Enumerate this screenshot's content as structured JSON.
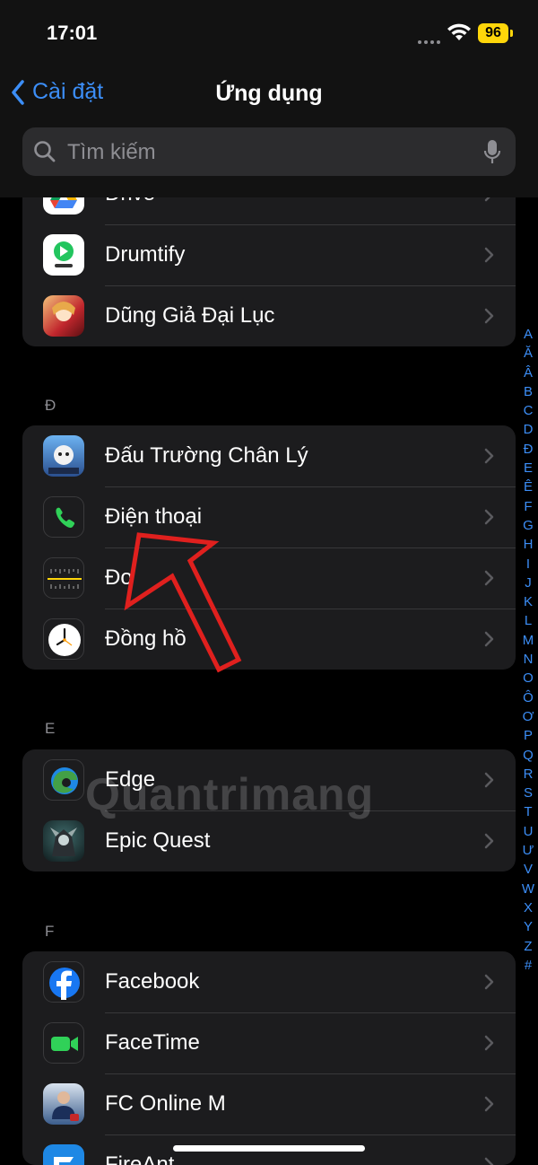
{
  "status": {
    "time": "17:01",
    "battery": "96"
  },
  "nav": {
    "back_label": "Cài đặt",
    "title": "Ứng dụng"
  },
  "search": {
    "placeholder": "Tìm kiếm"
  },
  "sections": {
    "d_top": {
      "items": [
        {
          "label": "Drive",
          "icon": "google-drive-icon"
        },
        {
          "label": "Drumtify",
          "icon": "drumtify-icon"
        },
        {
          "label": "Dũng Giả Đại Lục",
          "icon": "dung-gia-dai-luc-icon"
        }
      ]
    },
    "dd": {
      "letter": "Đ",
      "items": [
        {
          "label": "Đấu Trường Chân Lý",
          "icon": "dau-truong-chan-ly-icon"
        },
        {
          "label": "Điện thoại",
          "icon": "phone-icon"
        },
        {
          "label": "Đo",
          "icon": "measure-icon"
        },
        {
          "label": "Đồng hồ",
          "icon": "clock-icon"
        }
      ]
    },
    "e": {
      "letter": "E",
      "items": [
        {
          "label": "Edge",
          "icon": "edge-icon"
        },
        {
          "label": "Epic Quest",
          "icon": "epic-quest-icon"
        }
      ]
    },
    "f": {
      "letter": "F",
      "items": [
        {
          "label": "Facebook",
          "icon": "facebook-icon"
        },
        {
          "label": "FaceTime",
          "icon": "facetime-icon"
        },
        {
          "label": "FC Online M",
          "icon": "fc-online-icon"
        },
        {
          "label": "FireAnt",
          "icon": "fireant-icon"
        }
      ]
    }
  },
  "index_letters": [
    "A",
    "Ă",
    "Â",
    "B",
    "C",
    "D",
    "Đ",
    "E",
    "Ê",
    "F",
    "G",
    "H",
    "I",
    "J",
    "K",
    "L",
    "M",
    "N",
    "O",
    "Ô",
    "Ơ",
    "P",
    "Q",
    "R",
    "S",
    "T",
    "U",
    "Ư",
    "V",
    "W",
    "X",
    "Y",
    "Z",
    "#"
  ],
  "watermark": "Quantrimang",
  "colors": {
    "accent": "#3c8ef7",
    "battery": "#ffd60a",
    "group_bg": "#1c1c1e",
    "annotation_arrow": "#e0201e"
  }
}
